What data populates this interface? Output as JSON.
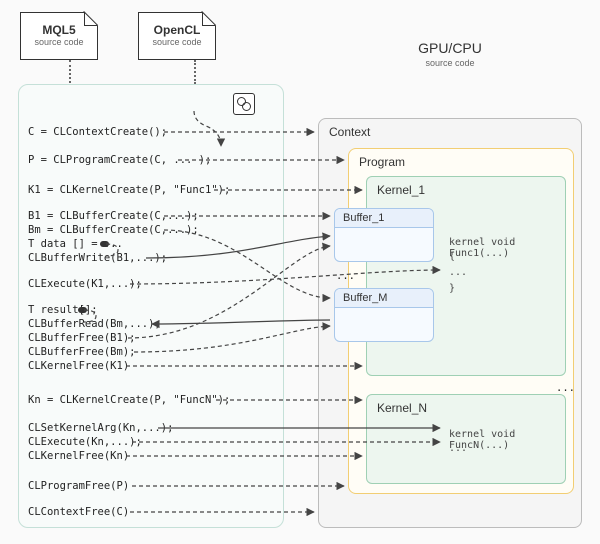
{
  "files": {
    "mql5_title": "MQL5",
    "mql5_sub": "source code",
    "opencl_title": "OpenCL",
    "opencl_sub": "source code"
  },
  "gpu": {
    "title": "GPU/CPU",
    "sub": "source code"
  },
  "boxes": {
    "context": "Context",
    "program": "Program",
    "kernel1": "Kernel_1",
    "kernelN": "Kernel_N",
    "buffer1": "Buffer_1",
    "bufferM": "Buffer_M",
    "ellipsis": "..."
  },
  "kernel1_code": {
    "l1": "kernel void Func1(...)",
    "l2": "{",
    "l3": "  ...",
    "l4": "}"
  },
  "kernelN_code": {
    "l1": "kernel void FuncN(...)",
    "l2": "..."
  },
  "lines": {
    "l_context": "C = CLContextCreate();",
    "l_program": "P = CLProgramCreate(C, ... );",
    "l_k1": "K1 = CLKernelCreate(P, \"Func1\");",
    "l_b1": "B1 = CLBufferCreate(C,...);",
    "l_bm": "Bm = CLBufferCreate(C,...);",
    "l_tdata": "T data [] = ...",
    "l_bwrite": "CLBufferWrite(B1,...);",
    "l_exec1": "CLExecute(K1,...);",
    "l_tres": "T result[];",
    "l_bread": "CLBufferRead(Bm,...);",
    "l_bfree1": "CLBufferFree(B1);",
    "l_bfreem": "CLBufferFree(Bm);",
    "l_kfree1": "CLKernelFree(K1)",
    "l_kn": "Kn = CLKernelCreate(P, \"FuncN\");",
    "l_setarg": "CLSetKernelArg(Kn,...);",
    "l_execn": "CLExecute(Kn,...);",
    "l_kfreen": "CLKernelFree(Kn)",
    "l_pfree": "CLProgramFree(P)",
    "l_cfree": "CLContextFree(C)"
  }
}
